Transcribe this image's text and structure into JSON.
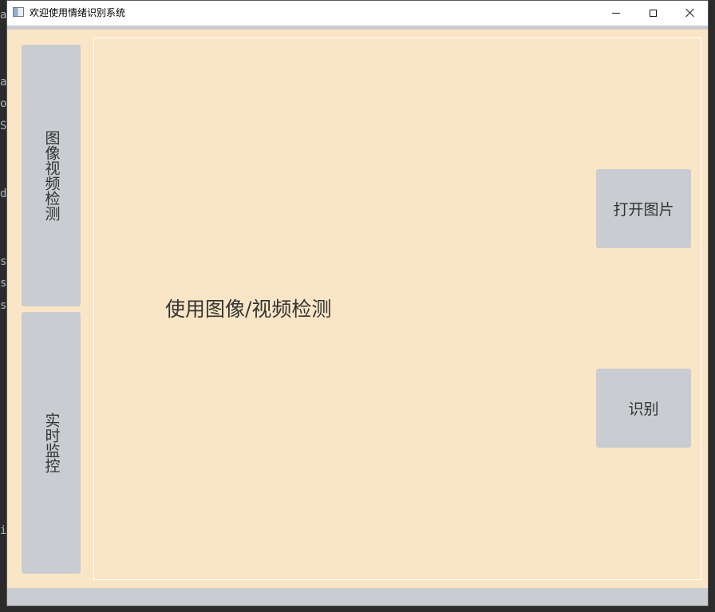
{
  "window": {
    "title": "欢迎使用情绪识别系统"
  },
  "sidebar": {
    "items": [
      {
        "label": "图像视频检测"
      },
      {
        "label": "实时监控"
      }
    ]
  },
  "main": {
    "label": "使用图像/视频检测"
  },
  "actions": {
    "open_image_label": "打开图片",
    "recognize_label": "识别"
  },
  "background_editor": {
    "lines": [
      "a",
      "o",
      "S",
      "d",
      "s",
      "s",
      "s",
      "i"
    ]
  },
  "colors": {
    "client_bg": "#fae6c6",
    "button_bg": "#c9ccd0",
    "titlebar_bg": "#ffffff"
  }
}
